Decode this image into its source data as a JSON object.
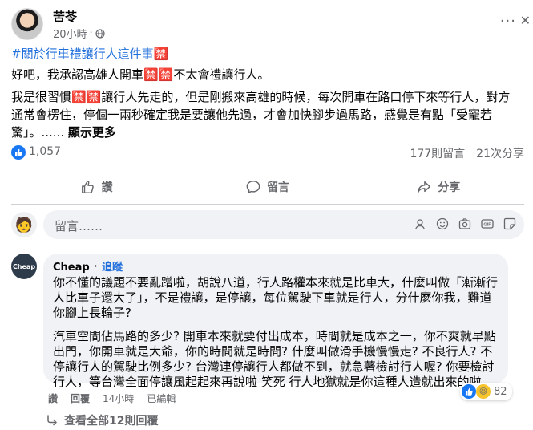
{
  "post": {
    "author": "苦苓",
    "time": "20小時",
    "hashtag": "#關於行車禮讓行人這件事🈲",
    "paragraph1": "好吧，我承認高雄人開車🈲🈲不太會禮讓行人。",
    "paragraph2": "我是很習慣🈲🈲讓行人先走的，但是剛搬來高雄的時候，每次開車在路口停下來等行人，對方通常會楞住，停個一兩秒確定我是要讓他先過，才會加快腳步過馬路，感覺是有點「受寵若驚」。......",
    "see_more": "顯示更多"
  },
  "stats": {
    "likes": "1,057",
    "comments": "177則留言",
    "shares": "21次分享"
  },
  "actions": {
    "like": "讚",
    "comment": "留言",
    "share": "分享"
  },
  "composer": {
    "placeholder": "留言……"
  },
  "comment": {
    "avatar_text": "Cheap",
    "name": "Cheap",
    "follow": "追蹤",
    "text1": "你不懂的議題不要亂蹭啦，胡說八道，行人路權本來就是比車大，什麼叫做「漸漸行人比車子還大了」，不是禮讓，是停讓，每位駕駛下車就是行人，分什麼你我，難道你腳上長輪子?",
    "text2": "汽車空間佔馬路的多少? 開車本來就要付出成本，時間就是成本之一，你不爽就早點出門，你開車就是大爺，你的時間就是時間? 什麼叫做滑手機慢慢走? 不良行人? 不停讓行人的駕駛比例多少? 台灣連停讓行人都做不到，就急著檢討行人喔? 你要檢討行人，等台灣全面停讓風起起來再說啦 笑死 行人地獄就是你這種人造就出來的啦",
    "like_action": "讚",
    "reply_action": "回覆",
    "time": "14小時",
    "edited": "已編輯",
    "reaction_count": "82"
  },
  "view_replies": "查看全部12則回覆",
  "colors": {
    "link": "#216fdb",
    "secondary": "#65676b",
    "like_blue": "#1877f2",
    "bubble": "#f0f2f5"
  }
}
